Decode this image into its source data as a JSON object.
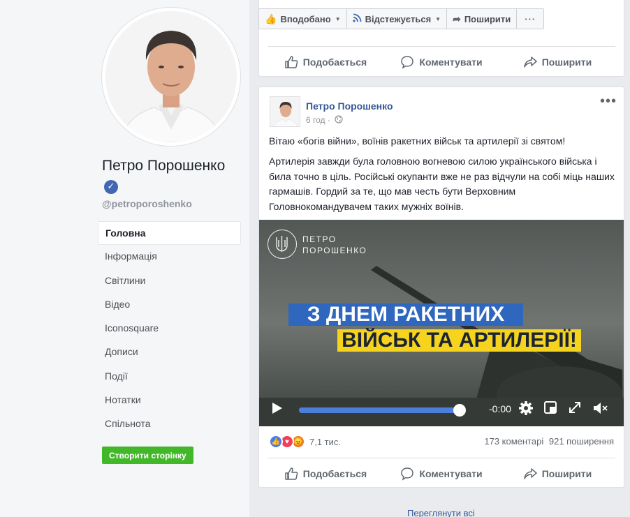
{
  "sidebar": {
    "name": "Петро Порошенко",
    "username": "@petroporoshenko",
    "nav": [
      {
        "label": "Головна",
        "active": true
      },
      {
        "label": "Інформація"
      },
      {
        "label": "Світлини"
      },
      {
        "label": "Відео"
      },
      {
        "label": "Iconosquare"
      },
      {
        "label": "Дописи"
      },
      {
        "label": "Події"
      },
      {
        "label": "Нотатки"
      },
      {
        "label": "Спільнота"
      }
    ],
    "create_button": "Створити сторінку"
  },
  "topbar": {
    "liked": "Вподобано",
    "following": "Відстежується",
    "share": "Поширити",
    "more": "···"
  },
  "prev_actions": {
    "like": "Подобається",
    "comment": "Коментувати",
    "share": "Поширити"
  },
  "post": {
    "author": "Петро Порошенко",
    "time": "6 год ·",
    "text1": "Вітаю «богів війни», воїнів ракетних військ та артилерії зі святом!",
    "text2": "Артилерія завжди була головною вогневою силою українського війська і била точно в ціль. Російські окупанти вже не раз відчули на собі міць наших гармашів. Гордий за те, що мав честь бути Верховним Головнокомандувачем таких мужніх воїнів.",
    "video": {
      "logo_line1": "ПЕТРО",
      "logo_line2": "ПОРОШЕНКО",
      "banner1": "З ДНЕМ РАКЕТНИХ",
      "banner2": "ВІЙСЬК ТА АРТИЛЕРІЇ!",
      "time": "-0:00",
      "progress": 1.0
    },
    "reaction_count": "7,1 тис.",
    "comments": "173 коментарі",
    "shares": "921 поширення",
    "actions": {
      "like": "Подобається",
      "comment": "Коментувати",
      "share": "Поширити"
    }
  },
  "see_all": "Переглянути всі",
  "colors": {
    "accent": "#4267b2",
    "link": "#365899",
    "green": "#42b72a",
    "blue_banner": "#2f66be",
    "yellow_banner": "#f6d31c"
  }
}
